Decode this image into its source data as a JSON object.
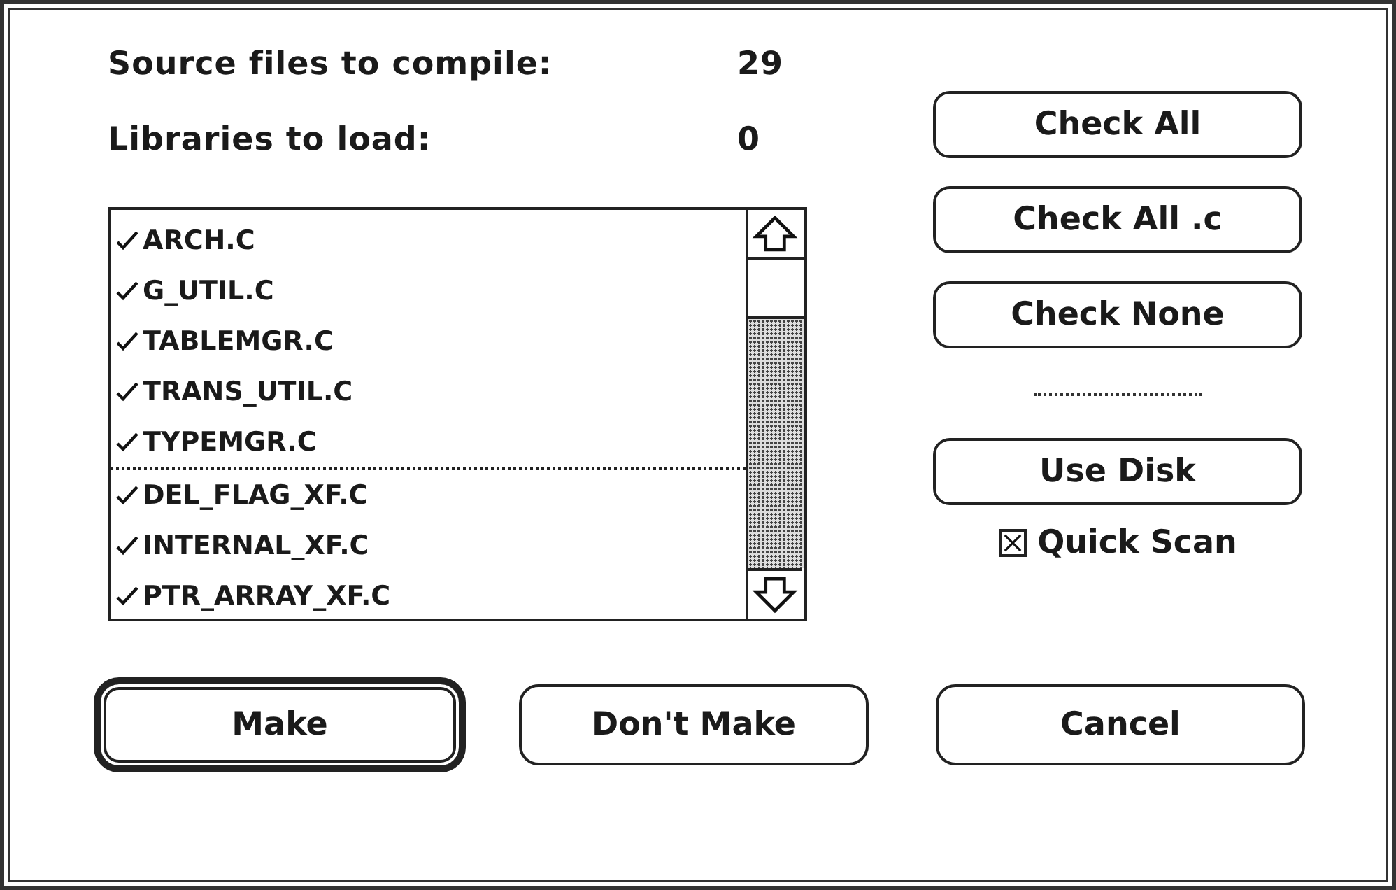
{
  "counts": [
    {
      "label": "Source files to compile:",
      "value": "29"
    },
    {
      "label": "Libraries to load:",
      "value": "0"
    }
  ],
  "file_groups": [
    {
      "files": [
        {
          "name": "ARCH.C",
          "checked": true
        },
        {
          "name": "G_UTIL.C",
          "checked": true
        },
        {
          "name": "TABLEMGR.C",
          "checked": true
        },
        {
          "name": "TRANS_UTIL.C",
          "checked": true
        },
        {
          "name": "TYPEMGR.C",
          "checked": true
        }
      ]
    },
    {
      "files": [
        {
          "name": "DEL_FLAG_XF.C",
          "checked": true
        },
        {
          "name": "INTERNAL_XF.C",
          "checked": true
        },
        {
          "name": "PTR_ARRAY_XF.C",
          "checked": true
        }
      ]
    }
  ],
  "check_buttons": [
    {
      "label": "Check All"
    },
    {
      "label": "Check All .c"
    },
    {
      "label": "Check None"
    }
  ],
  "disk_button": {
    "label": "Use Disk"
  },
  "quick_scan": {
    "label": "Quick Scan",
    "checked": true
  },
  "bottom_buttons": [
    {
      "label": "Make",
      "default": true
    },
    {
      "label": "Don't Make",
      "default": false
    },
    {
      "label": "Cancel",
      "default": false
    }
  ]
}
